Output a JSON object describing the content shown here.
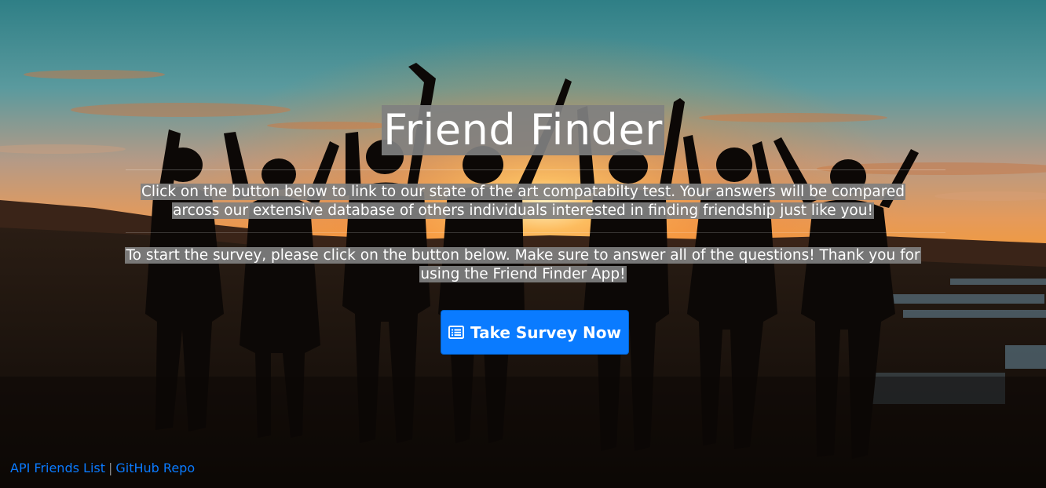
{
  "hero": {
    "title": "Friend Finder",
    "paragraph_1": "Click on the button below to link to our state of the art compatabilty test. Your answers will be compared arcoss our extensive database of others individuals interested in finding friendship just like you!",
    "paragraph_2": "To start the survey, please click on the button below. Make sure to answer all of the questions! Thank you for using the Friend Finder App!"
  },
  "survey_button": {
    "label": "Take Survey Now",
    "icon": "list-alt-icon",
    "color": "#0a7bff"
  },
  "footer": {
    "links": [
      {
        "label": "API Friends List"
      },
      {
        "label": "GitHub Repo"
      }
    ],
    "separator": "|"
  },
  "background": {
    "description_icon": "sunset-crowd-photo",
    "sky_top": "#3f8c8f",
    "sun": "#ffb347"
  }
}
